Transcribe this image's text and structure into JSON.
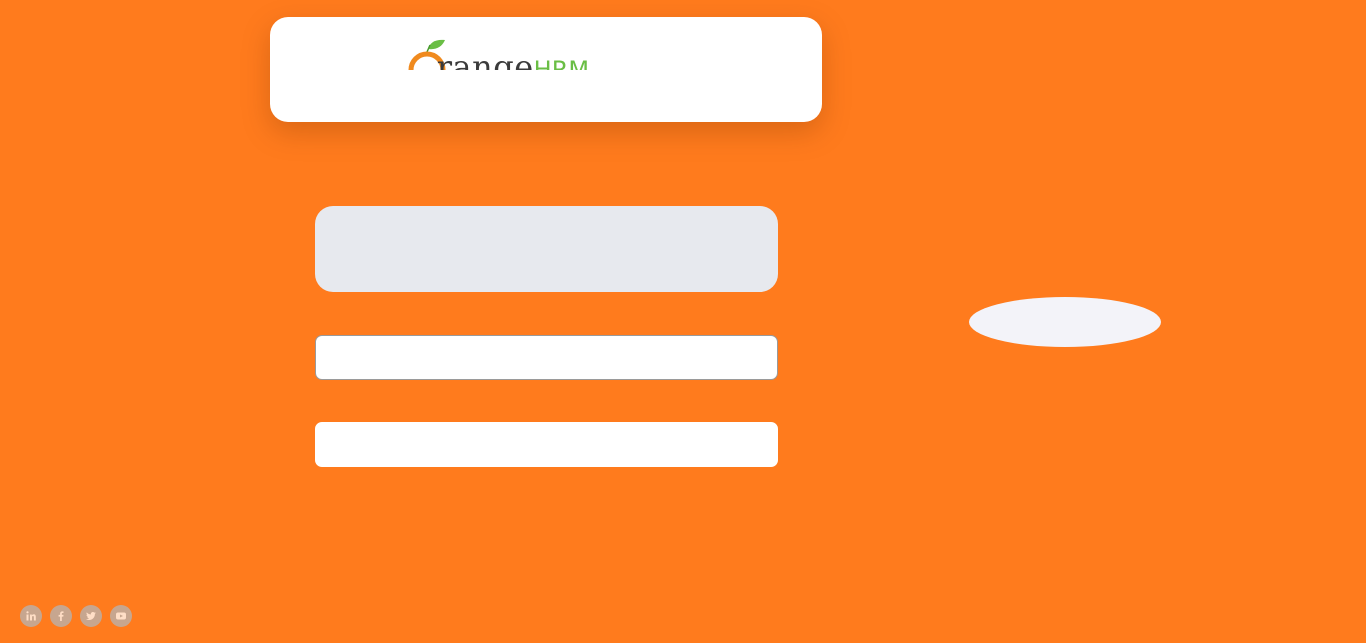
{
  "branding": {
    "logo_main": "range",
    "logo_accent": "HRM"
  },
  "login_form": {
    "username_placeholder": "",
    "password_placeholder": ""
  },
  "social_links": [
    {
      "icon": "linkedin-icon"
    },
    {
      "icon": "facebook-icon"
    },
    {
      "icon": "twitter-icon"
    },
    {
      "icon": "youtube-icon"
    }
  ],
  "colors": {
    "background": "#ff7b1d",
    "card": "#ffffff",
    "skeleton": "#e7e9ee",
    "logo_green": "#6abe45",
    "logo_orange": "#f08a1e",
    "social_icon": "#b5b5b5"
  }
}
